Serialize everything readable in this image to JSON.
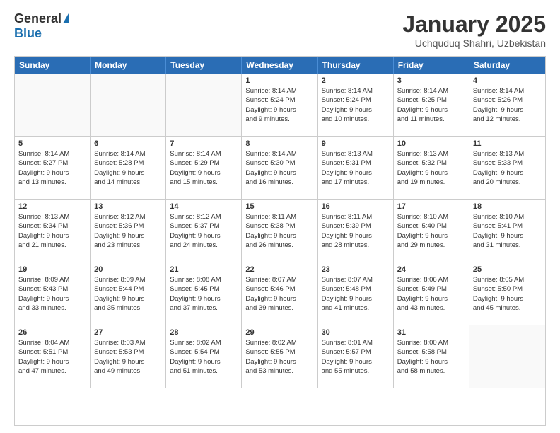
{
  "logo": {
    "general": "General",
    "blue": "Blue"
  },
  "title": "January 2025",
  "location": "Uchquduq Shahri, Uzbekistan",
  "header_days": [
    "Sunday",
    "Monday",
    "Tuesday",
    "Wednesday",
    "Thursday",
    "Friday",
    "Saturday"
  ],
  "weeks": [
    [
      {
        "day": "",
        "info": ""
      },
      {
        "day": "",
        "info": ""
      },
      {
        "day": "",
        "info": ""
      },
      {
        "day": "1",
        "info": "Sunrise: 8:14 AM\nSunset: 5:24 PM\nDaylight: 9 hours\nand 9 minutes."
      },
      {
        "day": "2",
        "info": "Sunrise: 8:14 AM\nSunset: 5:24 PM\nDaylight: 9 hours\nand 10 minutes."
      },
      {
        "day": "3",
        "info": "Sunrise: 8:14 AM\nSunset: 5:25 PM\nDaylight: 9 hours\nand 11 minutes."
      },
      {
        "day": "4",
        "info": "Sunrise: 8:14 AM\nSunset: 5:26 PM\nDaylight: 9 hours\nand 12 minutes."
      }
    ],
    [
      {
        "day": "5",
        "info": "Sunrise: 8:14 AM\nSunset: 5:27 PM\nDaylight: 9 hours\nand 13 minutes."
      },
      {
        "day": "6",
        "info": "Sunrise: 8:14 AM\nSunset: 5:28 PM\nDaylight: 9 hours\nand 14 minutes."
      },
      {
        "day": "7",
        "info": "Sunrise: 8:14 AM\nSunset: 5:29 PM\nDaylight: 9 hours\nand 15 minutes."
      },
      {
        "day": "8",
        "info": "Sunrise: 8:14 AM\nSunset: 5:30 PM\nDaylight: 9 hours\nand 16 minutes."
      },
      {
        "day": "9",
        "info": "Sunrise: 8:13 AM\nSunset: 5:31 PM\nDaylight: 9 hours\nand 17 minutes."
      },
      {
        "day": "10",
        "info": "Sunrise: 8:13 AM\nSunset: 5:32 PM\nDaylight: 9 hours\nand 19 minutes."
      },
      {
        "day": "11",
        "info": "Sunrise: 8:13 AM\nSunset: 5:33 PM\nDaylight: 9 hours\nand 20 minutes."
      }
    ],
    [
      {
        "day": "12",
        "info": "Sunrise: 8:13 AM\nSunset: 5:34 PM\nDaylight: 9 hours\nand 21 minutes."
      },
      {
        "day": "13",
        "info": "Sunrise: 8:12 AM\nSunset: 5:36 PM\nDaylight: 9 hours\nand 23 minutes."
      },
      {
        "day": "14",
        "info": "Sunrise: 8:12 AM\nSunset: 5:37 PM\nDaylight: 9 hours\nand 24 minutes."
      },
      {
        "day": "15",
        "info": "Sunrise: 8:11 AM\nSunset: 5:38 PM\nDaylight: 9 hours\nand 26 minutes."
      },
      {
        "day": "16",
        "info": "Sunrise: 8:11 AM\nSunset: 5:39 PM\nDaylight: 9 hours\nand 28 minutes."
      },
      {
        "day": "17",
        "info": "Sunrise: 8:10 AM\nSunset: 5:40 PM\nDaylight: 9 hours\nand 29 minutes."
      },
      {
        "day": "18",
        "info": "Sunrise: 8:10 AM\nSunset: 5:41 PM\nDaylight: 9 hours\nand 31 minutes."
      }
    ],
    [
      {
        "day": "19",
        "info": "Sunrise: 8:09 AM\nSunset: 5:43 PM\nDaylight: 9 hours\nand 33 minutes."
      },
      {
        "day": "20",
        "info": "Sunrise: 8:09 AM\nSunset: 5:44 PM\nDaylight: 9 hours\nand 35 minutes."
      },
      {
        "day": "21",
        "info": "Sunrise: 8:08 AM\nSunset: 5:45 PM\nDaylight: 9 hours\nand 37 minutes."
      },
      {
        "day": "22",
        "info": "Sunrise: 8:07 AM\nSunset: 5:46 PM\nDaylight: 9 hours\nand 39 minutes."
      },
      {
        "day": "23",
        "info": "Sunrise: 8:07 AM\nSunset: 5:48 PM\nDaylight: 9 hours\nand 41 minutes."
      },
      {
        "day": "24",
        "info": "Sunrise: 8:06 AM\nSunset: 5:49 PM\nDaylight: 9 hours\nand 43 minutes."
      },
      {
        "day": "25",
        "info": "Sunrise: 8:05 AM\nSunset: 5:50 PM\nDaylight: 9 hours\nand 45 minutes."
      }
    ],
    [
      {
        "day": "26",
        "info": "Sunrise: 8:04 AM\nSunset: 5:51 PM\nDaylight: 9 hours\nand 47 minutes."
      },
      {
        "day": "27",
        "info": "Sunrise: 8:03 AM\nSunset: 5:53 PM\nDaylight: 9 hours\nand 49 minutes."
      },
      {
        "day": "28",
        "info": "Sunrise: 8:02 AM\nSunset: 5:54 PM\nDaylight: 9 hours\nand 51 minutes."
      },
      {
        "day": "29",
        "info": "Sunrise: 8:02 AM\nSunset: 5:55 PM\nDaylight: 9 hours\nand 53 minutes."
      },
      {
        "day": "30",
        "info": "Sunrise: 8:01 AM\nSunset: 5:57 PM\nDaylight: 9 hours\nand 55 minutes."
      },
      {
        "day": "31",
        "info": "Sunrise: 8:00 AM\nSunset: 5:58 PM\nDaylight: 9 hours\nand 58 minutes."
      },
      {
        "day": "",
        "info": ""
      }
    ]
  ]
}
